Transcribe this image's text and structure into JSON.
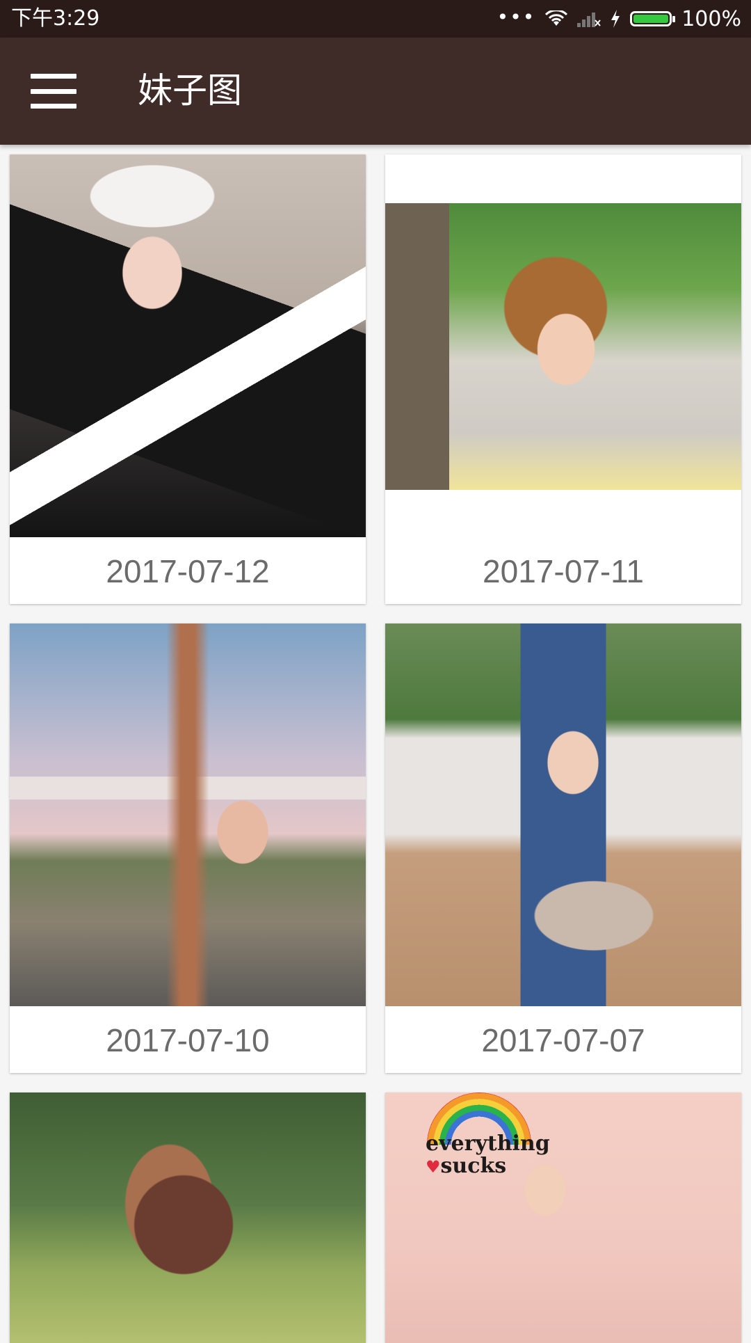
{
  "status_bar": {
    "time": "下午3:29",
    "dots": "•••",
    "battery_percent": "100%",
    "battery_level": 1.0,
    "battery_color": "#35c940"
  },
  "app_bar": {
    "title": "妹子图",
    "menu_icon": "hamburger-menu-icon",
    "background_color": "#3f2b28"
  },
  "gallery": {
    "items": [
      {
        "date": "2017-07-12"
      },
      {
        "date": "2017-07-11"
      },
      {
        "date": "2017-07-10"
      },
      {
        "date": "2017-07-07"
      },
      {
        "date": ""
      },
      {
        "date": ""
      }
    ]
  },
  "photo6": {
    "wall_line1": "everything",
    "wall_heart": "♥",
    "wall_line2": "sucks"
  }
}
